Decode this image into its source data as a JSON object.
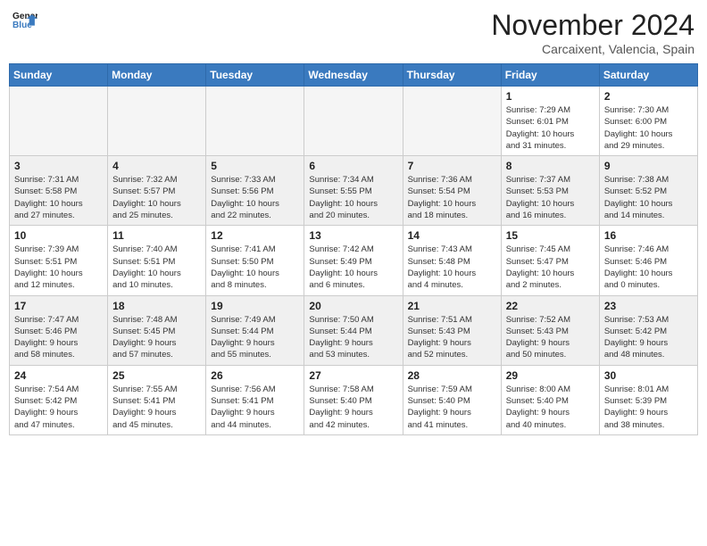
{
  "header": {
    "logo_line1": "General",
    "logo_line2": "Blue",
    "month_title": "November 2024",
    "location": "Carcaixent, Valencia, Spain"
  },
  "weekdays": [
    "Sunday",
    "Monday",
    "Tuesday",
    "Wednesday",
    "Thursday",
    "Friday",
    "Saturday"
  ],
  "weeks": [
    [
      {
        "day": "",
        "info": ""
      },
      {
        "day": "",
        "info": ""
      },
      {
        "day": "",
        "info": ""
      },
      {
        "day": "",
        "info": ""
      },
      {
        "day": "",
        "info": ""
      },
      {
        "day": "1",
        "info": "Sunrise: 7:29 AM\nSunset: 6:01 PM\nDaylight: 10 hours\nand 31 minutes."
      },
      {
        "day": "2",
        "info": "Sunrise: 7:30 AM\nSunset: 6:00 PM\nDaylight: 10 hours\nand 29 minutes."
      }
    ],
    [
      {
        "day": "3",
        "info": "Sunrise: 7:31 AM\nSunset: 5:58 PM\nDaylight: 10 hours\nand 27 minutes."
      },
      {
        "day": "4",
        "info": "Sunrise: 7:32 AM\nSunset: 5:57 PM\nDaylight: 10 hours\nand 25 minutes."
      },
      {
        "day": "5",
        "info": "Sunrise: 7:33 AM\nSunset: 5:56 PM\nDaylight: 10 hours\nand 22 minutes."
      },
      {
        "day": "6",
        "info": "Sunrise: 7:34 AM\nSunset: 5:55 PM\nDaylight: 10 hours\nand 20 minutes."
      },
      {
        "day": "7",
        "info": "Sunrise: 7:36 AM\nSunset: 5:54 PM\nDaylight: 10 hours\nand 18 minutes."
      },
      {
        "day": "8",
        "info": "Sunrise: 7:37 AM\nSunset: 5:53 PM\nDaylight: 10 hours\nand 16 minutes."
      },
      {
        "day": "9",
        "info": "Sunrise: 7:38 AM\nSunset: 5:52 PM\nDaylight: 10 hours\nand 14 minutes."
      }
    ],
    [
      {
        "day": "10",
        "info": "Sunrise: 7:39 AM\nSunset: 5:51 PM\nDaylight: 10 hours\nand 12 minutes."
      },
      {
        "day": "11",
        "info": "Sunrise: 7:40 AM\nSunset: 5:51 PM\nDaylight: 10 hours\nand 10 minutes."
      },
      {
        "day": "12",
        "info": "Sunrise: 7:41 AM\nSunset: 5:50 PM\nDaylight: 10 hours\nand 8 minutes."
      },
      {
        "day": "13",
        "info": "Sunrise: 7:42 AM\nSunset: 5:49 PM\nDaylight: 10 hours\nand 6 minutes."
      },
      {
        "day": "14",
        "info": "Sunrise: 7:43 AM\nSunset: 5:48 PM\nDaylight: 10 hours\nand 4 minutes."
      },
      {
        "day": "15",
        "info": "Sunrise: 7:45 AM\nSunset: 5:47 PM\nDaylight: 10 hours\nand 2 minutes."
      },
      {
        "day": "16",
        "info": "Sunrise: 7:46 AM\nSunset: 5:46 PM\nDaylight: 10 hours\nand 0 minutes."
      }
    ],
    [
      {
        "day": "17",
        "info": "Sunrise: 7:47 AM\nSunset: 5:46 PM\nDaylight: 9 hours\nand 58 minutes."
      },
      {
        "day": "18",
        "info": "Sunrise: 7:48 AM\nSunset: 5:45 PM\nDaylight: 9 hours\nand 57 minutes."
      },
      {
        "day": "19",
        "info": "Sunrise: 7:49 AM\nSunset: 5:44 PM\nDaylight: 9 hours\nand 55 minutes."
      },
      {
        "day": "20",
        "info": "Sunrise: 7:50 AM\nSunset: 5:44 PM\nDaylight: 9 hours\nand 53 minutes."
      },
      {
        "day": "21",
        "info": "Sunrise: 7:51 AM\nSunset: 5:43 PM\nDaylight: 9 hours\nand 52 minutes."
      },
      {
        "day": "22",
        "info": "Sunrise: 7:52 AM\nSunset: 5:43 PM\nDaylight: 9 hours\nand 50 minutes."
      },
      {
        "day": "23",
        "info": "Sunrise: 7:53 AM\nSunset: 5:42 PM\nDaylight: 9 hours\nand 48 minutes."
      }
    ],
    [
      {
        "day": "24",
        "info": "Sunrise: 7:54 AM\nSunset: 5:42 PM\nDaylight: 9 hours\nand 47 minutes."
      },
      {
        "day": "25",
        "info": "Sunrise: 7:55 AM\nSunset: 5:41 PM\nDaylight: 9 hours\nand 45 minutes."
      },
      {
        "day": "26",
        "info": "Sunrise: 7:56 AM\nSunset: 5:41 PM\nDaylight: 9 hours\nand 44 minutes."
      },
      {
        "day": "27",
        "info": "Sunrise: 7:58 AM\nSunset: 5:40 PM\nDaylight: 9 hours\nand 42 minutes."
      },
      {
        "day": "28",
        "info": "Sunrise: 7:59 AM\nSunset: 5:40 PM\nDaylight: 9 hours\nand 41 minutes."
      },
      {
        "day": "29",
        "info": "Sunrise: 8:00 AM\nSunset: 5:40 PM\nDaylight: 9 hours\nand 40 minutes."
      },
      {
        "day": "30",
        "info": "Sunrise: 8:01 AM\nSunset: 5:39 PM\nDaylight: 9 hours\nand 38 minutes."
      }
    ]
  ]
}
